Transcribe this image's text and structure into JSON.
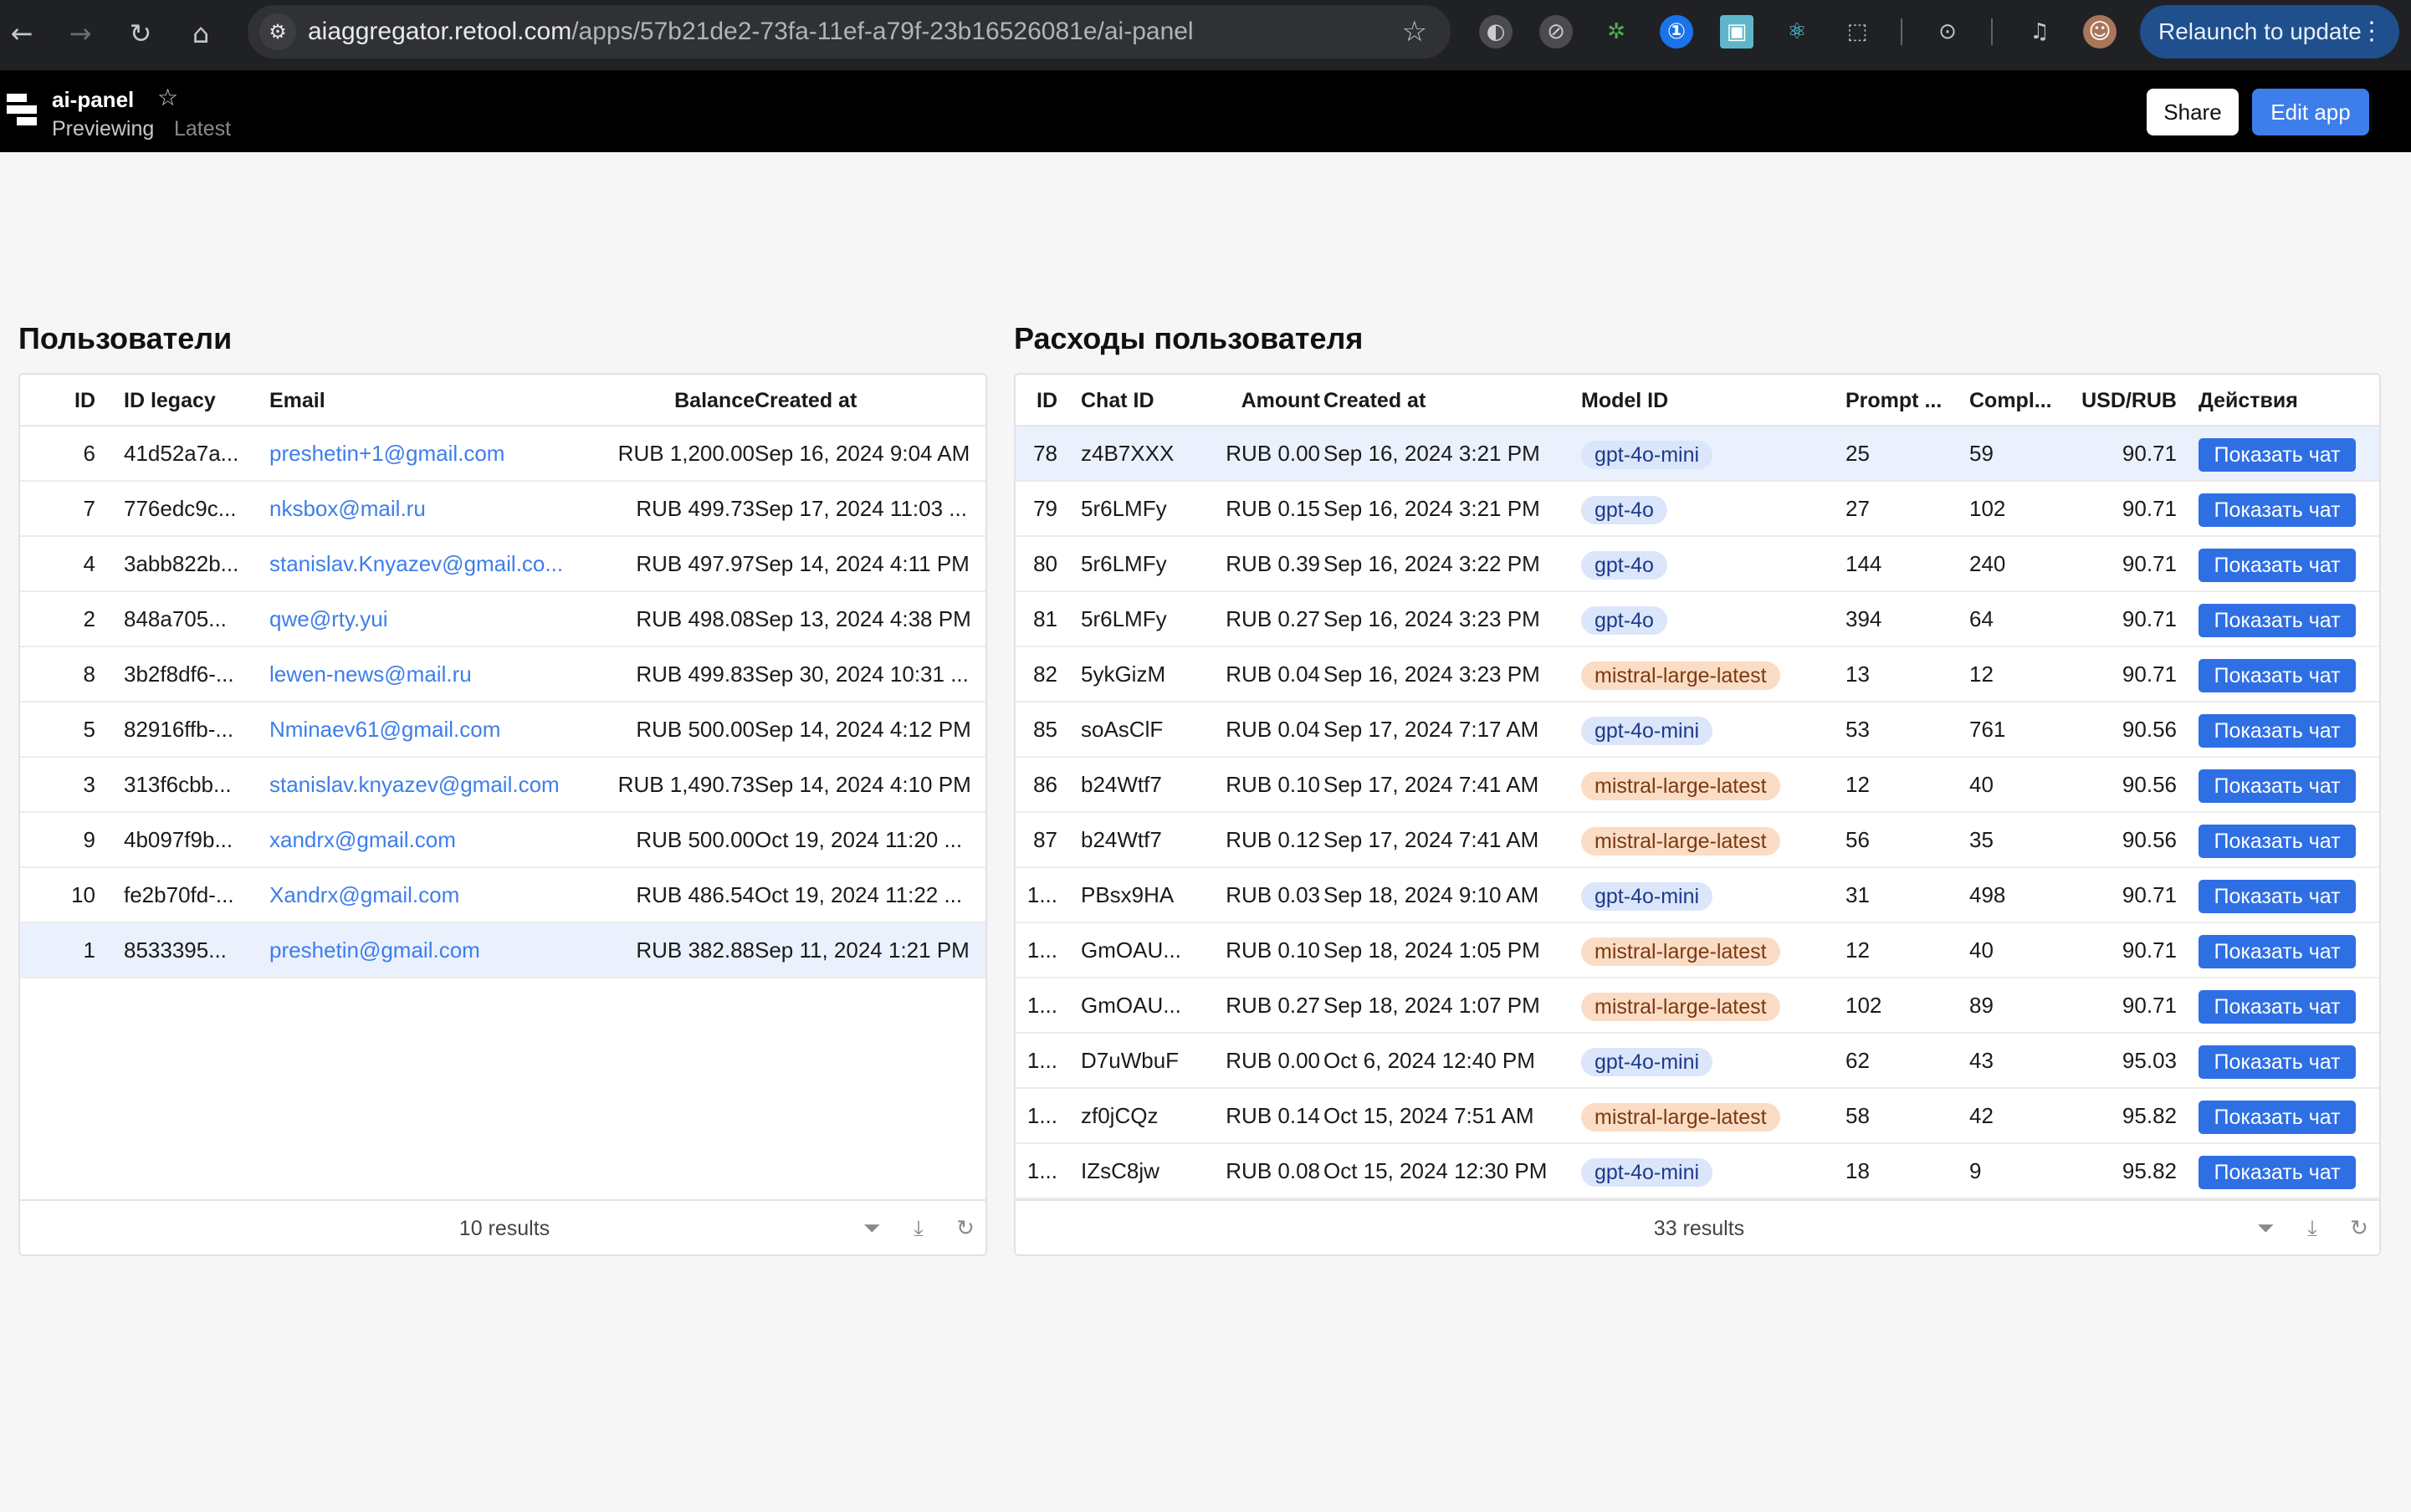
{
  "browser": {
    "url_host": "aiaggregator.retool.com",
    "url_path": "/apps/57b21de2-73fa-11ef-a79f-23b16526081e/ai-panel",
    "relaunch_label": "Relaunch to update"
  },
  "app": {
    "title": "ai-panel",
    "mode": "Previewing",
    "version": "Latest",
    "share_label": "Share",
    "edit_label": "Edit app"
  },
  "users": {
    "title": "Пользователи",
    "columns": [
      "ID",
      "ID legacy",
      "Email",
      "Balance",
      "Created at"
    ],
    "rows": [
      {
        "id": "6",
        "legacy": "41d52a7a...",
        "email": "preshetin+1@gmail.com",
        "balance": "RUB 1,200.00",
        "created": "Sep 16, 2024 9:04 AM"
      },
      {
        "id": "7",
        "legacy": "776edc9c...",
        "email": "nksbox@mail.ru",
        "balance": "RUB 499.73",
        "created": "Sep 17, 2024 11:03 ..."
      },
      {
        "id": "4",
        "legacy": "3abb822b...",
        "email": "stanislav.Knyazev@gmail.co...",
        "balance": "RUB 497.97",
        "created": "Sep 14, 2024 4:11 PM"
      },
      {
        "id": "2",
        "legacy": "848a705...",
        "email": "qwe@rty.yui",
        "balance": "RUB 498.08",
        "created": "Sep 13, 2024 4:38 PM"
      },
      {
        "id": "8",
        "legacy": "3b2f8df6-...",
        "email": "lewen-news@mail.ru",
        "balance": "RUB 499.83",
        "created": "Sep 30, 2024 10:31 ..."
      },
      {
        "id": "5",
        "legacy": "82916ffb-...",
        "email": "Nminaev61@gmail.com",
        "balance": "RUB 500.00",
        "created": "Sep 14, 2024 4:12 PM"
      },
      {
        "id": "3",
        "legacy": "313f6cbb...",
        "email": "stanislav.knyazev@gmail.com",
        "balance": "RUB 1,490.73",
        "created": "Sep 14, 2024 4:10 PM"
      },
      {
        "id": "9",
        "legacy": "4b097f9b...",
        "email": "xandrx@gmail.com",
        "balance": "RUB 500.00",
        "created": "Oct 19, 2024 11:20 ..."
      },
      {
        "id": "10",
        "legacy": "fe2b70fd-...",
        "email": "Xandrx@gmail.com",
        "balance": "RUB 486.54",
        "created": "Oct 19, 2024 11:22 ..."
      },
      {
        "id": "1",
        "legacy": "8533395...",
        "email": "preshetin@gmail.com",
        "balance": "RUB 382.88",
        "created": "Sep 11, 2024 1:21 PM"
      }
    ],
    "selected_index": 9,
    "results": "10 results"
  },
  "expenses": {
    "title": "Расходы пользователя",
    "columns": [
      "ID",
      "Chat ID",
      "Amount",
      "Created at",
      "Model ID",
      "Prompt ...",
      "Compl...",
      "USD/RUB",
      "Действия"
    ],
    "action_label": "Показать чат",
    "rows": [
      {
        "id": "78",
        "chat": "z4B7XXX",
        "amount": "RUB 0.00",
        "created": "Sep 16, 2024 3:21 PM",
        "model": "gpt-4o-mini",
        "prompt": "25",
        "compl": "59",
        "rate": "90.71"
      },
      {
        "id": "79",
        "chat": "5r6LMFy",
        "amount": "RUB 0.15",
        "created": "Sep 16, 2024 3:21 PM",
        "model": "gpt-4o",
        "prompt": "27",
        "compl": "102",
        "rate": "90.71"
      },
      {
        "id": "80",
        "chat": "5r6LMFy",
        "amount": "RUB 0.39",
        "created": "Sep 16, 2024 3:22 PM",
        "model": "gpt-4o",
        "prompt": "144",
        "compl": "240",
        "rate": "90.71"
      },
      {
        "id": "81",
        "chat": "5r6LMFy",
        "amount": "RUB 0.27",
        "created": "Sep 16, 2024 3:23 PM",
        "model": "gpt-4o",
        "prompt": "394",
        "compl": "64",
        "rate": "90.71"
      },
      {
        "id": "82",
        "chat": "5ykGizM",
        "amount": "RUB 0.04",
        "created": "Sep 16, 2024 3:23 PM",
        "model": "mistral-large-latest",
        "prompt": "13",
        "compl": "12",
        "rate": "90.71"
      },
      {
        "id": "85",
        "chat": "soAsClF",
        "amount": "RUB 0.04",
        "created": "Sep 17, 2024 7:17 AM",
        "model": "gpt-4o-mini",
        "prompt": "53",
        "compl": "761",
        "rate": "90.56"
      },
      {
        "id": "86",
        "chat": "b24Wtf7",
        "amount": "RUB 0.10",
        "created": "Sep 17, 2024 7:41 AM",
        "model": "mistral-large-latest",
        "prompt": "12",
        "compl": "40",
        "rate": "90.56"
      },
      {
        "id": "87",
        "chat": "b24Wtf7",
        "amount": "RUB 0.12",
        "created": "Sep 17, 2024 7:41 AM",
        "model": "mistral-large-latest",
        "prompt": "56",
        "compl": "35",
        "rate": "90.56"
      },
      {
        "id": "1...",
        "chat": "PBsx9HA",
        "amount": "RUB 0.03",
        "created": "Sep 18, 2024 9:10 AM",
        "model": "gpt-4o-mini",
        "prompt": "31",
        "compl": "498",
        "rate": "90.71"
      },
      {
        "id": "1...",
        "chat": "GmOAU...",
        "amount": "RUB 0.10",
        "created": "Sep 18, 2024 1:05 PM",
        "model": "mistral-large-latest",
        "prompt": "12",
        "compl": "40",
        "rate": "90.71"
      },
      {
        "id": "1...",
        "chat": "GmOAU...",
        "amount": "RUB 0.27",
        "created": "Sep 18, 2024 1:07 PM",
        "model": "mistral-large-latest",
        "prompt": "102",
        "compl": "89",
        "rate": "90.71"
      },
      {
        "id": "1...",
        "chat": "D7uWbuF",
        "amount": "RUB 0.00",
        "created": "Oct 6, 2024 12:40 PM",
        "model": "gpt-4o-mini",
        "prompt": "62",
        "compl": "43",
        "rate": "95.03"
      },
      {
        "id": "1...",
        "chat": "zf0jCQz",
        "amount": "RUB 0.14",
        "created": "Oct 15, 2024 7:51 AM",
        "model": "mistral-large-latest",
        "prompt": "58",
        "compl": "42",
        "rate": "95.82"
      },
      {
        "id": "1...",
        "chat": "IZsC8jw",
        "amount": "RUB 0.08",
        "created": "Oct 15, 2024 12:30 PM",
        "model": "gpt-4o-mini",
        "prompt": "18",
        "compl": "9",
        "rate": "95.82"
      }
    ],
    "selected_index": 0,
    "results": "33 results"
  },
  "colors": {
    "accent": "#3d7eea",
    "gpt_tag_bg": "#dbe6fb",
    "mistral_tag_bg": "#fbdcc4"
  }
}
